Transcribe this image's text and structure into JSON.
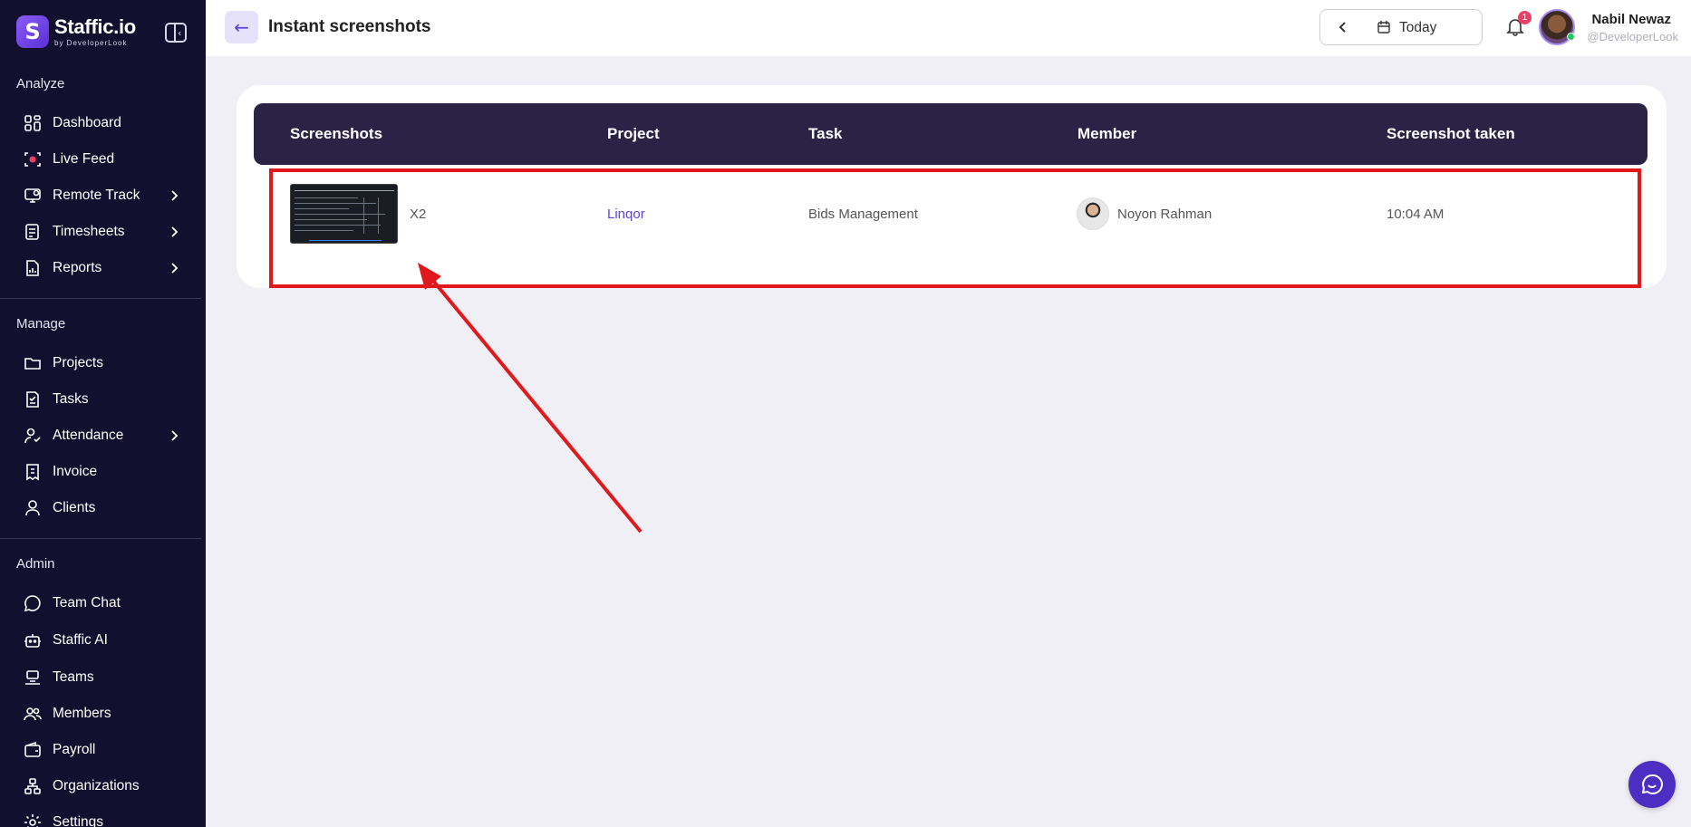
{
  "brand": {
    "name": "Staffic.io",
    "sub": "by DeveloperLook",
    "logo_letter": "S"
  },
  "sidebar": {
    "sections": [
      {
        "label": "Analyze"
      },
      {
        "label": "Manage"
      },
      {
        "label": "Admin"
      }
    ],
    "items": [
      {
        "label": "Dashboard",
        "icon": "dashboard-icon",
        "chevron": false
      },
      {
        "label": "Live Feed",
        "icon": "live-feed-icon",
        "chevron": false
      },
      {
        "label": "Remote Track",
        "icon": "remote-track-icon",
        "chevron": true
      },
      {
        "label": "Timesheets",
        "icon": "timesheets-icon",
        "chevron": true
      },
      {
        "label": "Reports",
        "icon": "reports-icon",
        "chevron": true
      },
      {
        "label": "Projects",
        "icon": "folder-icon",
        "chevron": false
      },
      {
        "label": "Tasks",
        "icon": "tasks-icon",
        "chevron": false
      },
      {
        "label": "Attendance",
        "icon": "attendance-icon",
        "chevron": true
      },
      {
        "label": "Invoice",
        "icon": "invoice-icon",
        "chevron": false
      },
      {
        "label": "Clients",
        "icon": "user-icon",
        "chevron": false
      },
      {
        "label": "Team Chat",
        "icon": "chat-icon",
        "chevron": false
      },
      {
        "label": "Staffic AI",
        "icon": "robot-icon",
        "chevron": false
      },
      {
        "label": "Teams",
        "icon": "teams-icon",
        "chevron": false
      },
      {
        "label": "Members",
        "icon": "members-icon",
        "chevron": false
      },
      {
        "label": "Payroll",
        "icon": "wallet-icon",
        "chevron": false
      },
      {
        "label": "Organizations",
        "icon": "organization-icon",
        "chevron": false
      },
      {
        "label": "Settings",
        "icon": "gear-icon",
        "chevron": false
      }
    ]
  },
  "header": {
    "back_icon": "←",
    "title": "Instant screenshots",
    "date_label": "Today",
    "notification_count": "1",
    "user_name": "Nabil Newaz",
    "user_handle": "@DeveloperLook"
  },
  "table": {
    "headers": [
      "Screenshots",
      "Project",
      "Task",
      "Member",
      "Screenshot taken"
    ],
    "rows": [
      {
        "screenshot_label": "X2",
        "project": "Linqor",
        "task": "Bids Management",
        "member": "Noyon Rahman",
        "time": "10:04 AM"
      }
    ]
  },
  "colors": {
    "sidebar_bg": "#130f2e",
    "accent": "#5b43d6",
    "table_header_bg": "#2a2346",
    "annotation_red": "#e0191d",
    "badge": "#ef3e63"
  }
}
